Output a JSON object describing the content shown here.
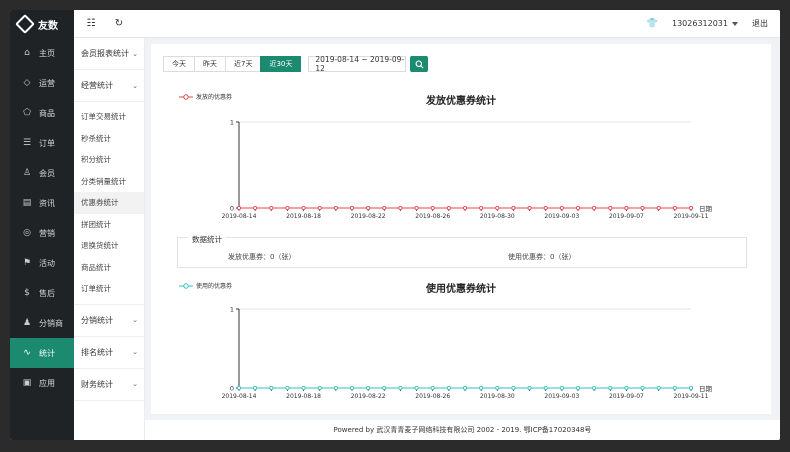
{
  "brand": {
    "name": "友数"
  },
  "nav": {
    "items": [
      {
        "name": "nav-home",
        "icon": "home-icon",
        "glyph": "⌂",
        "label": "主页"
      },
      {
        "name": "nav-operation",
        "icon": "shield-icon",
        "glyph": "◇",
        "label": "运营"
      },
      {
        "name": "nav-goods",
        "icon": "tag-icon",
        "glyph": "⬠",
        "label": "商品"
      },
      {
        "name": "nav-orders",
        "icon": "list-icon",
        "glyph": "☰",
        "label": "订单"
      },
      {
        "name": "nav-members",
        "icon": "user-icon",
        "glyph": "♙",
        "label": "会员"
      },
      {
        "name": "nav-news",
        "icon": "news-icon",
        "glyph": "▤",
        "label": "资讯"
      },
      {
        "name": "nav-marketing",
        "icon": "coin-icon",
        "glyph": "◎",
        "label": "营销"
      },
      {
        "name": "nav-activity",
        "icon": "flag-icon",
        "glyph": "⚑",
        "label": "活动"
      },
      {
        "name": "nav-aftersale",
        "icon": "dollar-icon",
        "glyph": "$",
        "label": "售后"
      },
      {
        "name": "nav-distributor",
        "icon": "person-icon",
        "glyph": "♟",
        "label": "分销商"
      },
      {
        "name": "nav-statistics",
        "icon": "pulse-icon",
        "glyph": "∿",
        "label": "统计",
        "active": true
      },
      {
        "name": "nav-apps",
        "icon": "app-icon",
        "glyph": "▣",
        "label": "应用"
      }
    ]
  },
  "topbar": {
    "user": "13026312031",
    "logout": "退出"
  },
  "subnav": {
    "groups": [
      {
        "label": "会员报表统计",
        "items": []
      },
      {
        "label": "经营统计",
        "items": [
          "订单交易统计",
          "秒杀统计",
          "积分统计",
          "分类销量统计",
          "优惠券统计",
          "拼团统计",
          "退换货统计",
          "商品统计",
          "订单统计"
        ],
        "active": "优惠券统计"
      },
      {
        "label": "分销统计",
        "items": []
      },
      {
        "label": "排名统计",
        "items": []
      },
      {
        "label": "财务统计",
        "items": []
      }
    ]
  },
  "filters": {
    "buttons": [
      {
        "label": "今天",
        "active": false
      },
      {
        "label": "昨天",
        "active": false
      },
      {
        "label": "近7天",
        "active": false
      },
      {
        "label": "近30天",
        "active": true
      }
    ],
    "date_range": "2019-08-14 ~ 2019-09-12"
  },
  "stats": {
    "title": "数据统计",
    "issued": "发放优惠券：0（张）",
    "used": "使用优惠券：0（张）"
  },
  "colors": {
    "accent": "#1b8a6f",
    "issued": "#e04a4a",
    "used": "#3bbfbf"
  },
  "chart_data": [
    {
      "type": "line",
      "title": "发放优惠券统计",
      "xlabel": "日期",
      "ylim": [
        0,
        1
      ],
      "yticks": [
        0,
        1
      ],
      "x": [
        "2019-08-14",
        "2019-08-15",
        "2019-08-16",
        "2019-08-17",
        "2019-08-18",
        "2019-08-19",
        "2019-08-20",
        "2019-08-21",
        "2019-08-22",
        "2019-08-23",
        "2019-08-24",
        "2019-08-25",
        "2019-08-26",
        "2019-08-27",
        "2019-08-28",
        "2019-08-29",
        "2019-08-30",
        "2019-08-31",
        "2019-09-01",
        "2019-09-02",
        "2019-09-03",
        "2019-09-04",
        "2019-09-05",
        "2019-09-06",
        "2019-09-07",
        "2019-09-08",
        "2019-09-09",
        "2019-09-10",
        "2019-09-11"
      ],
      "x_tick_labels": [
        "2019-08-14",
        "2019-08-18",
        "2019-08-22",
        "2019-08-26",
        "2019-08-30",
        "2019-09-03",
        "2019-09-07",
        "2019-09-11"
      ],
      "series": [
        {
          "name": "发放的优惠券",
          "color": "#e04a4a",
          "values": [
            0,
            0,
            0,
            0,
            0,
            0,
            0,
            0,
            0,
            0,
            0,
            0,
            0,
            0,
            0,
            0,
            0,
            0,
            0,
            0,
            0,
            0,
            0,
            0,
            0,
            0,
            0,
            0,
            0
          ]
        }
      ]
    },
    {
      "type": "line",
      "title": "使用优惠券统计",
      "xlabel": "日期",
      "ylim": [
        0,
        1
      ],
      "yticks": [
        0,
        1
      ],
      "x": [
        "2019-08-14",
        "2019-08-15",
        "2019-08-16",
        "2019-08-17",
        "2019-08-18",
        "2019-08-19",
        "2019-08-20",
        "2019-08-21",
        "2019-08-22",
        "2019-08-23",
        "2019-08-24",
        "2019-08-25",
        "2019-08-26",
        "2019-08-27",
        "2019-08-28",
        "2019-08-29",
        "2019-08-30",
        "2019-08-31",
        "2019-09-01",
        "2019-09-02",
        "2019-09-03",
        "2019-09-04",
        "2019-09-05",
        "2019-09-06",
        "2019-09-07",
        "2019-09-08",
        "2019-09-09",
        "2019-09-10",
        "2019-09-11"
      ],
      "x_tick_labels": [
        "2019-08-14",
        "2019-08-18",
        "2019-08-22",
        "2019-08-26",
        "2019-08-30",
        "2019-09-03",
        "2019-09-07",
        "2019-09-11"
      ],
      "series": [
        {
          "name": "使用的优惠券",
          "color": "#3bbfbf",
          "values": [
            0,
            0,
            0,
            0,
            0,
            0,
            0,
            0,
            0,
            0,
            0,
            0,
            0,
            0,
            0,
            0,
            0,
            0,
            0,
            0,
            0,
            0,
            0,
            0,
            0,
            0,
            0,
            0,
            0
          ]
        }
      ]
    }
  ],
  "footer": {
    "text": "Powered by 武汉青青麦子网络科技有限公司 2002 - 2019. 鄂ICP备17020348号"
  }
}
